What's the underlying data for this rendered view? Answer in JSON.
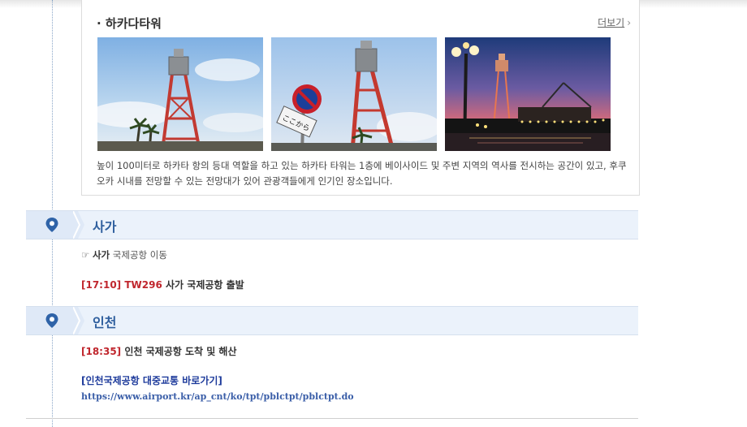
{
  "attraction": {
    "title": "· 하카다타워",
    "more_label": "더보기",
    "more_arrow": "›",
    "description": "높이 100미터로 하카타 항의 등대 역할을 하고 있는 하카타 타워는 1층에 베이사이드 및 주변 지역의 역사를 전시하는 공간이 있고, 후쿠오카 시내를 전망할 수 있는 전망대가 있어 관광객들에게 인기인 장소입니다.",
    "sign_text": "ここから"
  },
  "sections": {
    "saga": {
      "title": "사가",
      "note_bold": "사가",
      "note_rest": " 국제공항 이동",
      "schedule": {
        "time": "[17:10]",
        "flight": "TW296",
        "text": " 사가 국제공항 출발"
      }
    },
    "incheon": {
      "title": "인천",
      "schedule": {
        "time": "[18:35]",
        "text": " 인천 국제공항 도착 및 해산"
      },
      "link_title": "[인천국제공항 대중교통 바로가기]",
      "link_url": "https://www.airport.kr/ap_cnt/ko/tpt/pblctpt/pblctpt.do"
    }
  },
  "colors": {
    "accent": "#2f5f9e",
    "time_red": "#c0262d",
    "link_blue": "#1f3c9c"
  },
  "icons": {
    "location": "map-pin-icon",
    "note": "finger-point-icon"
  }
}
